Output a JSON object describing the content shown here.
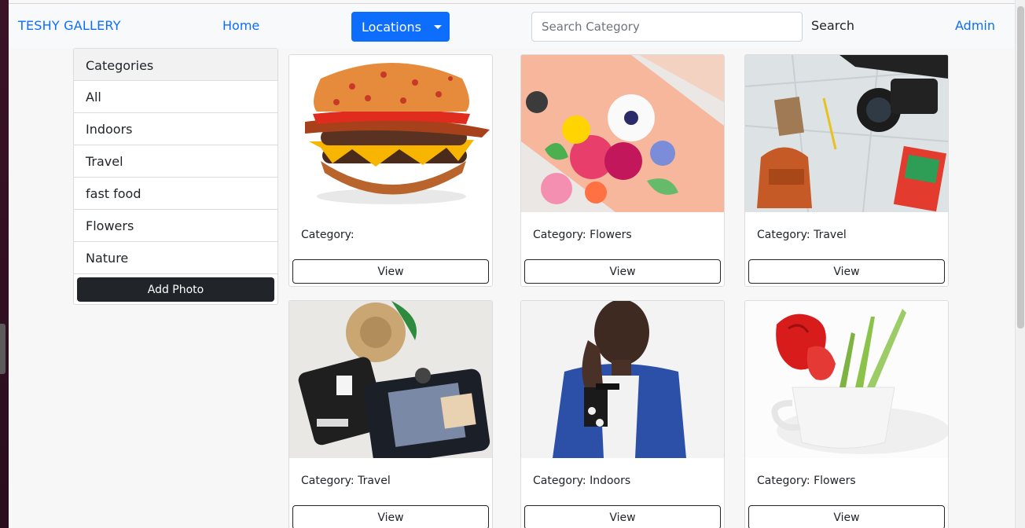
{
  "navbar": {
    "brand": "TESHY GALLERY",
    "home": "Home",
    "locations": "Locations",
    "search_placeholder": "Search Category",
    "search_button": "Search",
    "admin": "Admin"
  },
  "sidebar": {
    "header": "Categories",
    "items": [
      {
        "label": "All"
      },
      {
        "label": "Indoors"
      },
      {
        "label": "Travel"
      },
      {
        "label": "fast food"
      },
      {
        "label": "Flowers"
      },
      {
        "label": "Nature"
      }
    ],
    "add_photo": "Add Photo"
  },
  "gallery": {
    "cards": [
      {
        "category_text": "Category:",
        "view": "View",
        "image": "burger-photo"
      },
      {
        "category_text": "Category: Flowers",
        "view": "View",
        "image": "flower-bouquet-photo"
      },
      {
        "category_text": "Category: Travel",
        "view": "View",
        "image": "travel-map-camera-photo"
      },
      {
        "category_text": "Category: Travel",
        "view": "View",
        "image": "suitcase-packing-photo"
      },
      {
        "category_text": "Category: Indoors",
        "view": "View",
        "image": "portrait-photo"
      },
      {
        "category_text": "Category: Flowers",
        "view": "View",
        "image": "tulip-cup-photo"
      }
    ]
  },
  "colors": {
    "link": "#0d6efd",
    "primary_button": "#0d6efd",
    "dark_button": "#212529",
    "navbar_bg": "#f8f9fa"
  }
}
